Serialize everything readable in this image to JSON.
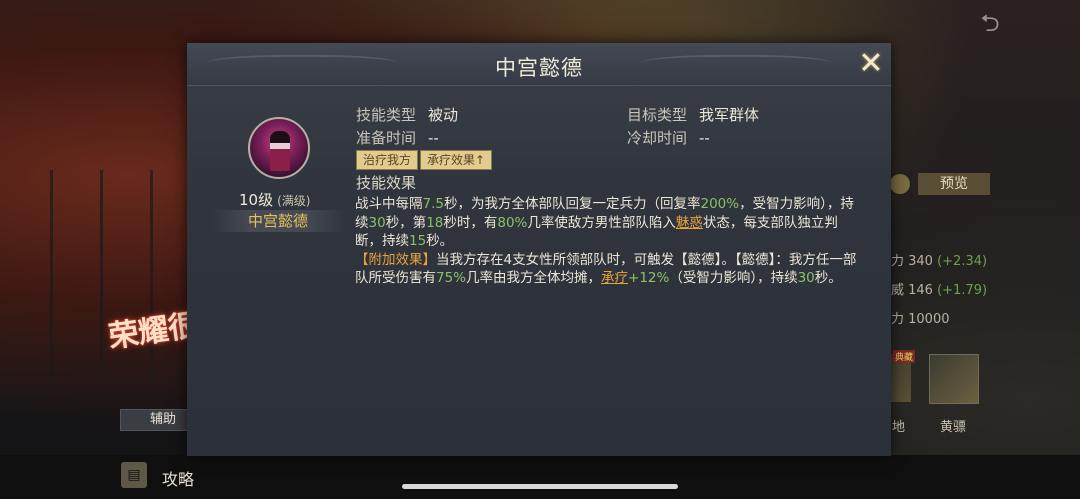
{
  "background": {
    "logo_text": "荣耀很",
    "role_tab": "辅助",
    "back_icon": "back-arrow-icon",
    "preview_button": "预览",
    "stats": [
      {
        "label": "力 340",
        "bonus": "(+2.34)"
      },
      {
        "label": "威 146",
        "bonus": "(+1.79)"
      },
      {
        "label": "力 10000",
        "bonus": ""
      }
    ],
    "hero_tag": "典藏",
    "hero_labels": [
      "地",
      "黄骠"
    ],
    "guide_label": "攻略"
  },
  "dialog": {
    "title": "中宫懿德",
    "close_icon": "close-icon",
    "level": "10级",
    "level_max": "(满级)",
    "skill_name": "中宫懿德",
    "fields": {
      "type_label": "技能类型",
      "type_value": "被动",
      "target_label": "目标类型",
      "target_value": "我军群体",
      "prep_label": "准备时间",
      "prep_value": "--",
      "cooldown_label": "冷却时间",
      "cooldown_value": "--"
    },
    "tags": [
      "治疗我方",
      "承疗效果↑"
    ],
    "effect_label": "技能效果",
    "description": {
      "p1": [
        "战斗中每隔",
        "7.5",
        "秒，为我方全体部队回复一定兵力（回复率",
        "200%",
        "，受智力影响），持续",
        "30",
        "秒，第",
        "18",
        "秒时，有",
        "80%",
        "几率使敌方男性部队陷入",
        "魅惑",
        "状态，每支部队独立判断，持续",
        "15",
        "秒。"
      ],
      "p2": [
        "【附加效果】",
        "当我方存在4支女性所领部队时，可触发【懿德】。【懿德】：我方任一部队所受伤害有",
        "75%",
        "几率由我方全体均摊，",
        "承疗",
        "+12%",
        "（受智力影响），持续",
        "30",
        "秒。"
      ]
    }
  }
}
